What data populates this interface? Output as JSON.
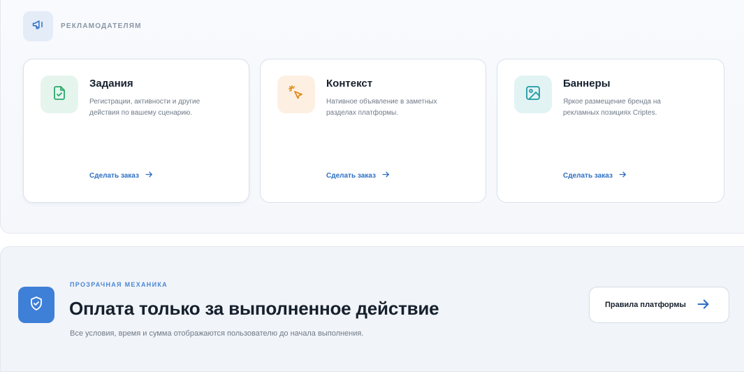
{
  "advertisers": {
    "label": "РЕКЛАМОДАТЕЛЯМ",
    "icon": "megaphone-icon"
  },
  "cards": [
    {
      "title": "Задания",
      "description": "Регистрации, активности и другие действия по вашему сценарию.",
      "link": "Сделать заказ",
      "icon": "file-check-icon",
      "accent": "#2aa86b"
    },
    {
      "title": "Контекст",
      "description": "Нативное объявление в заметных разделах платформы.",
      "link": "Сделать заказ",
      "icon": "cursor-click-icon",
      "accent": "#e08a1c"
    },
    {
      "title": "Баннеры",
      "description": "Яркое размещение бренда на рекламных позициях Criptes.",
      "link": "Сделать заказ",
      "icon": "image-icon",
      "accent": "#1f9aa3"
    }
  ],
  "mechanics": {
    "label": "ПРОЗРАЧНАЯ МЕХАНИКА",
    "title": "Оплата только за выполненное действие",
    "description": "Все условия, время и сумма отображаются пользователю до начала выполнения.",
    "button": "Правила платформы",
    "icon": "shield-check-icon"
  },
  "colors": {
    "link": "#2d6fc4",
    "shield_bg": "#3e7fd8"
  }
}
